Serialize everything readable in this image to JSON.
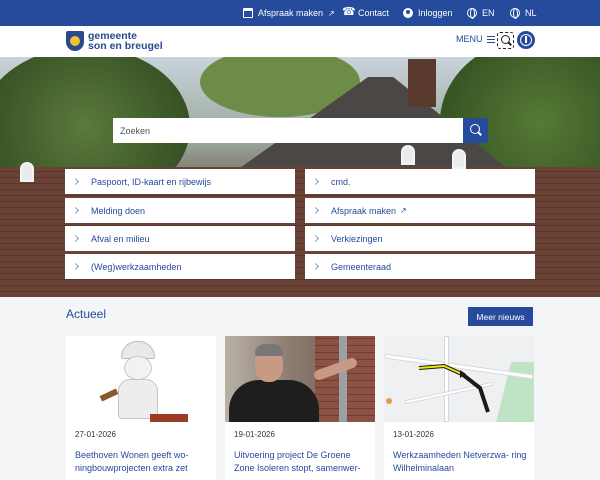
{
  "topbar": {
    "appointment": "Afspraak maken",
    "contact": "Contact",
    "login": "Inloggen",
    "lang_en": "EN",
    "lang_nl": "NL"
  },
  "header": {
    "logo_line1": "gemeente",
    "logo_line2": "son en breugel",
    "menu_label": "MENU"
  },
  "search": {
    "placeholder": "Zoeken"
  },
  "quick_links": [
    {
      "label": "Paspoort, ID-kaart en rijbewijs"
    },
    {
      "label": "cmd."
    },
    {
      "label": "Melding doen"
    },
    {
      "label": "Afspraak maken"
    },
    {
      "label": "Afval en milieu"
    },
    {
      "label": "Verkiezingen"
    },
    {
      "label": "(Weg)werkzaamheden"
    },
    {
      "label": "Gemeenteraad"
    }
  ],
  "news": {
    "heading": "Actueel",
    "more_label": "Meer nieuws",
    "items": [
      {
        "date": "27-01-2026",
        "title": "Beethoven Wonen geeft wo- ningbouwprojecten extra zet"
      },
      {
        "date": "19-01-2026",
        "title": "Uitvoering project De Groene Zone Isoleren stopt, samenwer-"
      },
      {
        "date": "13-01-2026",
        "title": "Werkzaamheden Netverzwa- ring Wilhelminalaan"
      }
    ]
  },
  "colors": {
    "brand_blue": "#264a9c",
    "page_bg": "#f4f5f7"
  },
  "icons": [
    "calendar-icon",
    "phone-icon",
    "user-icon",
    "globe-icon",
    "search-icon",
    "accessibility-icon",
    "chevron-right-icon",
    "external-link-icon"
  ]
}
